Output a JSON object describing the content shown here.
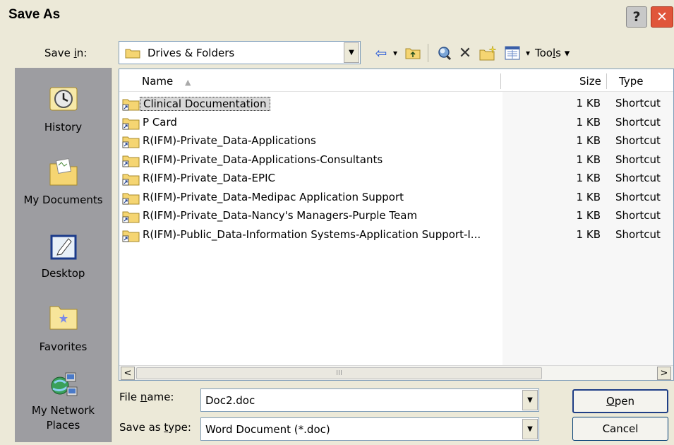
{
  "window": {
    "title": "Save As",
    "help_glyph": "?",
    "close_glyph": "✕"
  },
  "savein": {
    "label_pre": "Save ",
    "label_u": "i",
    "label_post": "n:",
    "value": "Drives & Folders",
    "arrow_glyph": "▼"
  },
  "toolbar": {
    "back_glyph": "⇦",
    "back_arrow": "▾",
    "tools_pre": "Too",
    "tools_u": "l",
    "tools_post": "s",
    "tools_arrow": "▾",
    "views_arrow": "▾",
    "delete_glyph": "✕"
  },
  "places": [
    {
      "label": "History"
    },
    {
      "label": "My Documents"
    },
    {
      "label": "Desktop"
    },
    {
      "label": "Favorites"
    },
    {
      "label": "My Network Places"
    }
  ],
  "filelist": {
    "columns": {
      "name": "Name",
      "sort_glyph": "▲",
      "size": "Size",
      "type": "Type"
    },
    "rows": [
      {
        "name": "Clinical Documentation",
        "size": "1 KB",
        "type": "Shortcut"
      },
      {
        "name": "P Card",
        "size": "1 KB",
        "type": "Shortcut"
      },
      {
        "name": "R(IFM)-Private_Data-Applications",
        "size": "1 KB",
        "type": "Shortcut"
      },
      {
        "name": "R(IFM)-Private_Data-Applications-Consultants",
        "size": "1 KB",
        "type": "Shortcut"
      },
      {
        "name": "R(IFM)-Private_Data-EPIC",
        "size": "1 KB",
        "type": "Shortcut"
      },
      {
        "name": "R(IFM)-Private_Data-Medipac Application Support",
        "size": "1 KB",
        "type": "Shortcut"
      },
      {
        "name": "R(IFM)-Private_Data-Nancy's Managers-Purple Team",
        "size": "1 KB",
        "type": "Shortcut"
      },
      {
        "name": "R(IFM)-Public_Data-Information Systems-Application Support-I...",
        "size": "1 KB",
        "type": "Shortcut"
      }
    ],
    "selected_index": 0,
    "scroll_left_glyph": "<",
    "scroll_right_glyph": ">",
    "thumb_grip": "III"
  },
  "filename": {
    "label_pre": "File ",
    "label_u": "n",
    "label_post": "ame:",
    "value": "Doc2.doc",
    "arrow_glyph": "▼"
  },
  "savetype": {
    "label_pre": "Save as ",
    "label_u": "t",
    "label_post": "ype:",
    "value": "Word Document (*.doc)",
    "arrow_glyph": "▼"
  },
  "buttons": {
    "open_u": "O",
    "open_post": "pen",
    "cancel": "Cancel"
  },
  "colors": {
    "places_bg": "#9d9da1",
    "dialog_bg": "#ece9d8",
    "close_red": "#e0553a",
    "folder_yellow": "#f5d572"
  }
}
